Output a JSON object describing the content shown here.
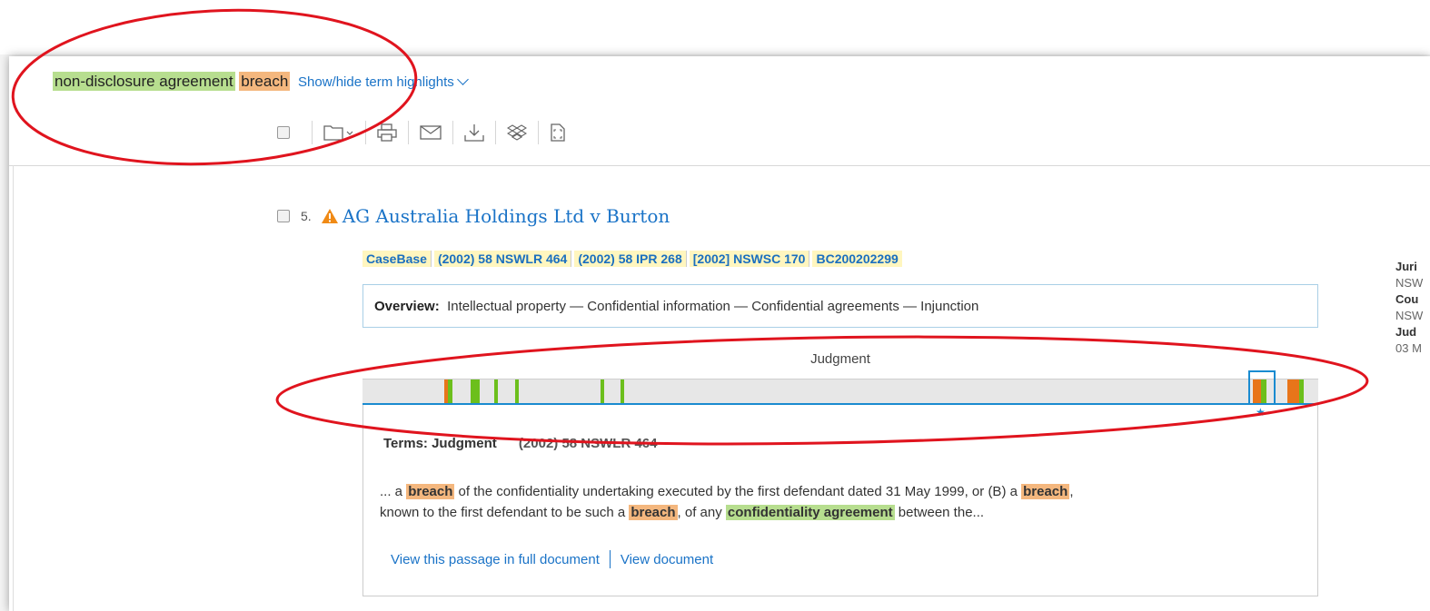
{
  "search_terms": {
    "term1": "non-disclosure agreement",
    "term2": "breach",
    "show_hide_label": "Show/hide term highlights"
  },
  "toolbar": {
    "icons": [
      "select-all-checkbox",
      "folder-icon",
      "print-icon",
      "email-icon",
      "download-icon",
      "dropbox-icon",
      "document-icon"
    ]
  },
  "result": {
    "number": "5.",
    "title": "AG Australia Holdings Ltd v Burton",
    "citations": [
      "CaseBase",
      "(2002) 58 NSWLR 464",
      "(2002) 58 IPR 268",
      "[2002] NSWSC 170",
      "BC200202299"
    ],
    "overview_label": "Overview:",
    "overview_text": "Intellectual property — Confidential information — Confidential agreements — Injunction",
    "judgment_label": "Judgment",
    "passage_terms_label": "Terms: Judgment",
    "passage_citation": "(2002) 58 NSWLR 464",
    "snippet": {
      "s1": "... a ",
      "k1": "breach",
      "s2": " of the confidentiality undertaking executed by the first defendant dated 31 May 1999, or (B) a ",
      "k2": "breach",
      "s3": ",",
      "s4": "known to the first defendant to be such a ",
      "k3": "breach",
      "s5": ", of any ",
      "k4": "confidentiality agreement",
      "s6": " between the..."
    },
    "link_passage": "View this passage in full document",
    "link_document": "View document"
  },
  "meta": {
    "l1": "Juri",
    "l2": "NSW",
    "l3": "Cou",
    "l4": "NSW",
    "l5": "Jud",
    "l6": "03 M"
  },
  "colors": {
    "green_highlight": "#b7de8f",
    "orange_highlight": "#f4b77e",
    "link_blue": "#1a73c7",
    "annotation_red": "#e0141e",
    "green_mark": "#6cbf1c",
    "orange_mark": "#e8751a"
  }
}
